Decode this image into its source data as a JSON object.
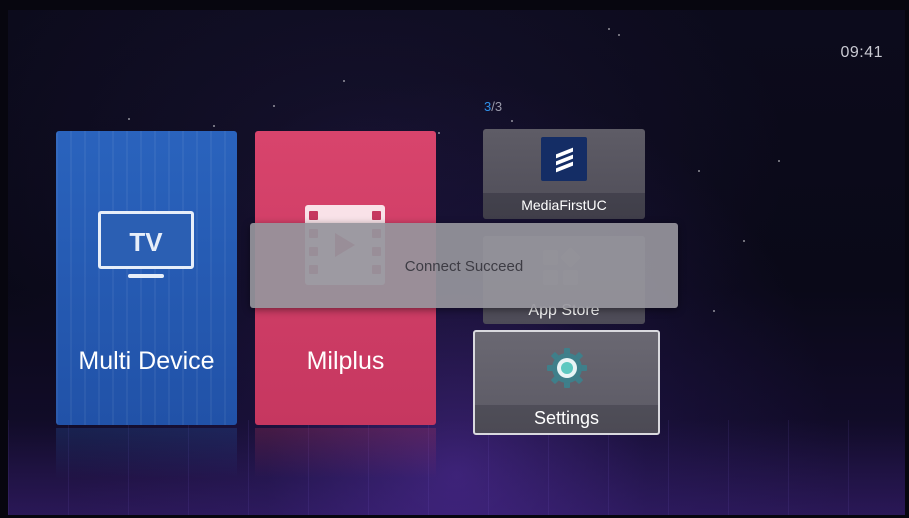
{
  "status": {
    "clock": "09:41"
  },
  "pager": {
    "current": "3",
    "total": "/3"
  },
  "tiles": [
    {
      "label": "Multi Device",
      "icon_text": "TV",
      "icon": "tv-icon",
      "color": "#2a63bd"
    },
    {
      "label": "Milplus",
      "icon": "film-icon",
      "color": "#d8446c"
    }
  ],
  "apps": [
    {
      "label": "MediaFirstUC",
      "icon": "ericsson-logo-icon"
    },
    {
      "label": "App Store",
      "icon": "app-grid-icon"
    },
    {
      "label": "Settings",
      "icon": "gear-icon"
    }
  ],
  "toast": {
    "message": "Connect Succeed"
  }
}
